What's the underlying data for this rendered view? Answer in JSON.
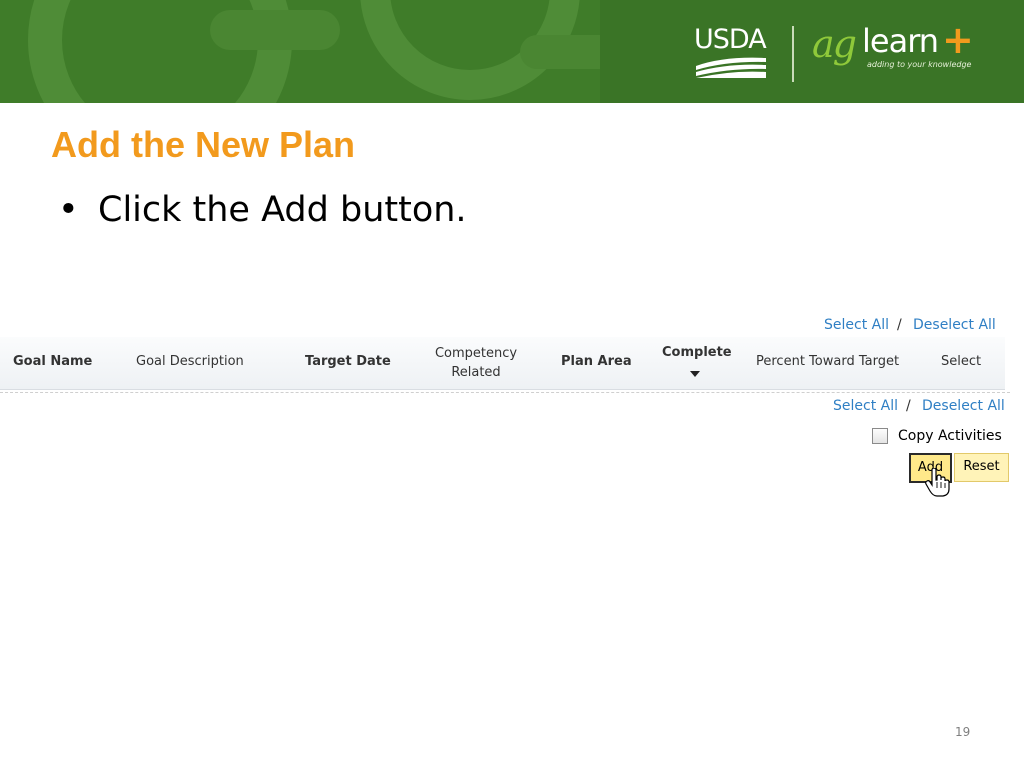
{
  "header": {
    "usda_logo_text": "USDA",
    "aglearn_ag": "ag",
    "aglearn_learn": "learn",
    "aglearn_plus": "+",
    "aglearn_tagline": "adding to your knowledge",
    "banner_color": "#3f7c29"
  },
  "slide": {
    "title": "Add the New Plan",
    "bullet": "Click the Add button.",
    "title_color": "#f29a1d",
    "page_number": "19"
  },
  "screenshot": {
    "select_all_top": "Select All",
    "separator_top": "/",
    "deselect_all_top": "Deselect All",
    "columns": {
      "goal_name": "Goal Name",
      "goal_description": "Goal Description",
      "target_date": "Target Date",
      "competency_line1": "Competency",
      "competency_line2": "Related",
      "plan_area": "Plan Area",
      "complete": "Complete",
      "percent_toward_target": "Percent Toward Target",
      "select": "Select"
    },
    "select_all_bottom": "Select All",
    "separator_bottom": "/",
    "deselect_all_bottom": "Deselect All",
    "copy_activities_label": "Copy Activities",
    "add_button": "Add",
    "reset_button": "Reset",
    "link_color": "#2f7fc4"
  }
}
